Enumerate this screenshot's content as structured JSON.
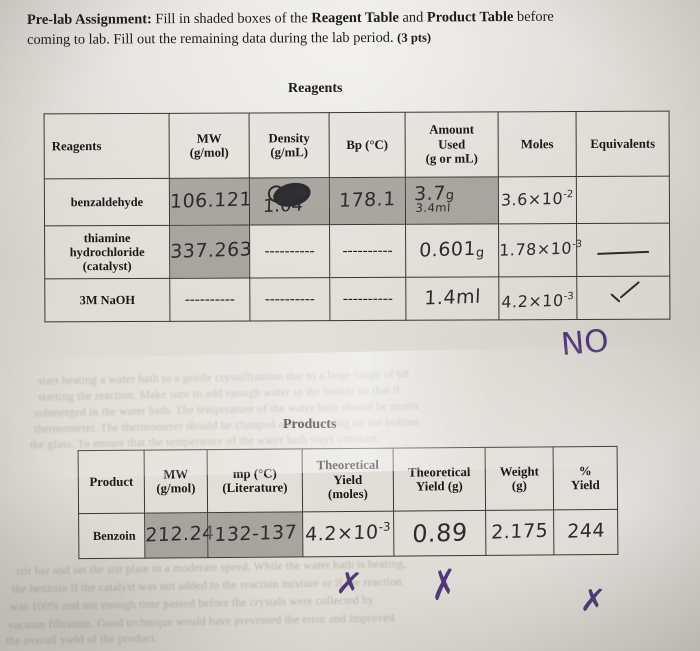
{
  "instructions": {
    "lead": "Pre-lab Assignment:",
    "body_1": "Fill in shaded boxes of the",
    "bold_1": "Reagent Table",
    "mid": "and",
    "bold_2": "Product Table",
    "body_2": "before",
    "line2": "coming to lab.  Fill out the remaining data during the lab period.",
    "points": "(3 pts)"
  },
  "reagent_table": {
    "title": "Reagents",
    "columns": [
      "Reagents",
      "MW\n(g/mol)",
      "Density\n(g/mL)",
      "Bp (°C)",
      "Amount\nUsed\n(g or mL)",
      "Moles",
      "Equivalents"
    ],
    "columns_flat": {
      "reagents": "Reagents",
      "mw_l1": "MW",
      "mw_l2": "(g/mol)",
      "density_l1": "Density",
      "density_l2": "(g/mL)",
      "bp": "Bp (°C)",
      "amount_l1": "Amount",
      "amount_l2": "Used",
      "amount_l3": "(g or mL)",
      "moles": "Moles",
      "equivalents": "Equivalents"
    },
    "rows": [
      {
        "name": "benzaldehyde",
        "mw": "106.121",
        "density_crossed_out": true,
        "density": "1.04",
        "bp": "178.1",
        "amount": "3.7",
        "amount_unit": "g",
        "amount_note": "3.4ml",
        "moles_mantissa": "3.6×10",
        "moles_exponent": "-2",
        "equivalents": ""
      },
      {
        "name": "thiamine hydrochloride (catalyst)",
        "name_l1": "thiamine",
        "name_l2": "hydrochloride",
        "name_l3": "(catalyst)",
        "mw": "337.263",
        "density": "----------",
        "bp": "----------",
        "amount": "0.601",
        "amount_unit": "g",
        "moles_mantissa": "1.78×10",
        "moles_exponent": "-3",
        "equivalents": "—"
      },
      {
        "name": "3M NaOH",
        "mw": "----------",
        "density": "----------",
        "bp": "----------",
        "amount": "1.4ml",
        "moles_mantissa": "4.2×10",
        "moles_exponent": "-3",
        "equivalents": "checkmark"
      }
    ]
  },
  "product_table": {
    "title": "Products",
    "columns_flat": {
      "product": "Product",
      "mw_l1": "MW",
      "mw_l2": "(g/mol)",
      "mp_l1": "mp (°C)",
      "mp_l2": "(Literature)",
      "theo_moles_l1": "Theoretical",
      "theo_moles_l2": "Yield",
      "theo_moles_l3": "(moles)",
      "theo_g_l1": "Theoretical",
      "theo_g_l2": "Yield  (g)",
      "weight_l1": "Weight",
      "weight_l2": "(g)",
      "pct_l1": "%",
      "pct_l2": "Yield"
    },
    "rows": [
      {
        "product": "Benzoin",
        "mw": "212.24",
        "mp": "132-137",
        "theoretical_yield_moles_mantissa": "4.2×10",
        "theoretical_yield_moles_exponent": "-3",
        "theoretical_yield_g": "0.89",
        "weight_g": "2.175",
        "percent_yield": "244"
      }
    ]
  },
  "grader_marks": {
    "no": "NO",
    "x1": "✗",
    "x2": "✗",
    "x3": "✗",
    "ink_color": "#4e3a78"
  },
  "bleed_through": {
    "line1": "start heating a water bath to a gentle crystallization due to a large range of 68",
    "line2": "starting the reaction.     Make sure to add enough water to the beaker so that it",
    "line3": "submerged in the water bath.  The temperature of the water bath should be monit",
    "line4": "thermometer.  The thermometer should be clamped and not resting on the bottom",
    "line5": "the glass.  To ensure that the temperature of the water bath stays constant,",
    "line6": "stir bar and set the stir plate to a moderate speed.  While the water bath is heating,",
    "line7": "the benzoin if the catalyst was not added to the reaction mixture or if the reaction",
    "line8": "was 100% and not enough time passed before the crystals were collected by",
    "line9": "vacuum filtration.  Good technique would have prevented the error and improved",
    "line10": "the overall yield of the product."
  }
}
